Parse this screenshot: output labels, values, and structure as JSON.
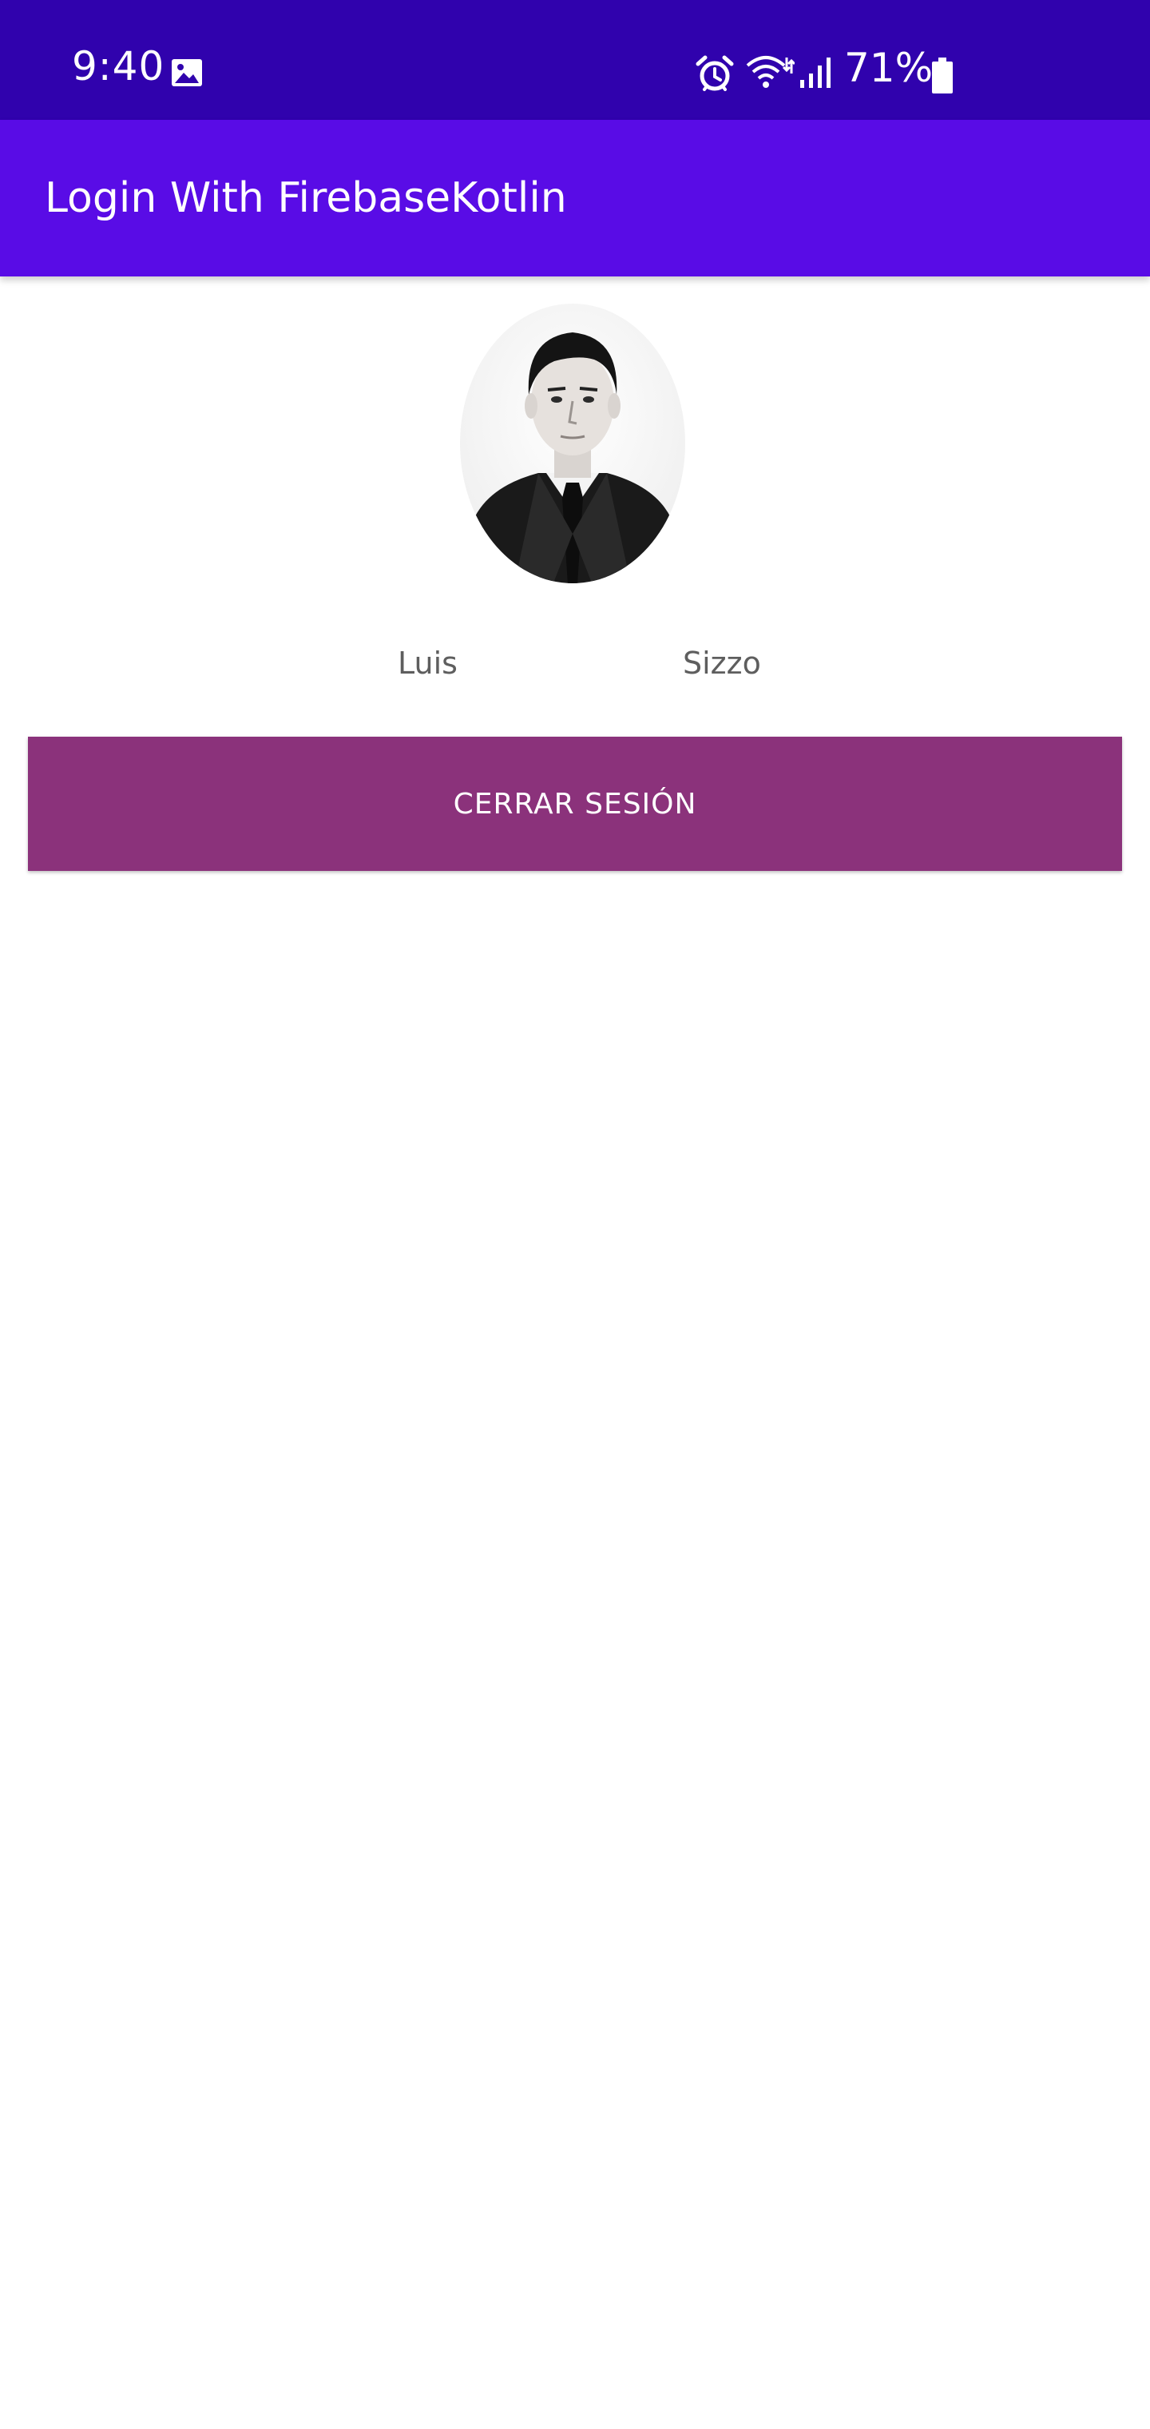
{
  "status_bar": {
    "time": "9:40",
    "battery_percent": "71%",
    "icons": [
      "gallery-icon",
      "alarm-icon",
      "wifi-icon",
      "signal-icon",
      "battery-icon"
    ]
  },
  "app_bar": {
    "title": "Login With FirebaseKotlin"
  },
  "profile": {
    "first_name": "Luis",
    "last_name": "Sizzo"
  },
  "actions": {
    "logout_label": "CERRAR SESIÓN"
  },
  "colors": {
    "status_bar": "#3002ad",
    "app_bar": "#590ce6",
    "button": "#8b327b",
    "name_text": "#5e5e5e"
  }
}
